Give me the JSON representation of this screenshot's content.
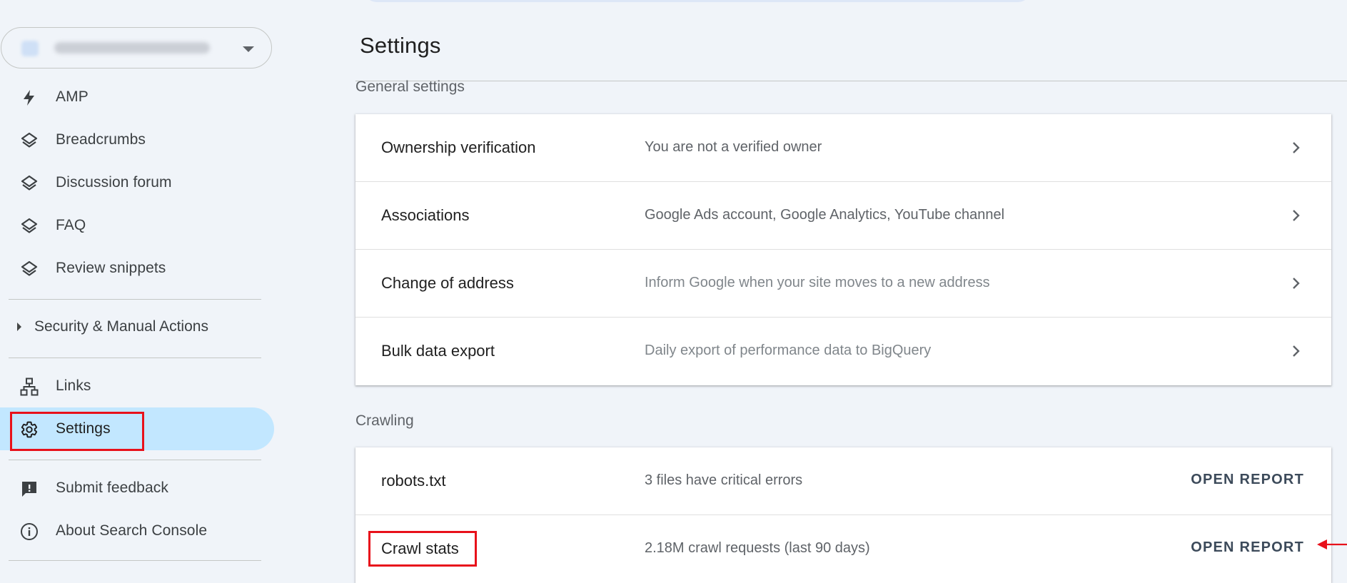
{
  "sidebar": {
    "items_top": [
      {
        "label": "AMP",
        "icon": "lightning-bolt-icon"
      },
      {
        "label": "Breadcrumbs",
        "icon": "layers-icon"
      },
      {
        "label": "Discussion forum",
        "icon": "layers-icon"
      },
      {
        "label": "FAQ",
        "icon": "layers-icon"
      },
      {
        "label": "Review snippets",
        "icon": "layers-icon"
      }
    ],
    "security_group": {
      "label": "Security & Manual Actions"
    },
    "links": {
      "label": "Links",
      "icon": "sitemap-icon"
    },
    "settings": {
      "label": "Settings",
      "icon": "gear-icon"
    },
    "submit_feedback": {
      "label": "Submit feedback",
      "icon": "feedback-icon"
    },
    "about": {
      "label": "About Search Console",
      "icon": "info-icon"
    }
  },
  "main": {
    "title": "Settings",
    "general": {
      "label": "General settings",
      "rows": [
        {
          "title": "Ownership verification",
          "desc": "You are not a verified owner"
        },
        {
          "title": "Associations",
          "desc": "Google Ads account, Google Analytics, YouTube channel"
        },
        {
          "title": "Change of address",
          "desc": "Inform Google when your site moves to a new address"
        },
        {
          "title": "Bulk data export",
          "desc": "Daily export of performance data to BigQuery"
        }
      ]
    },
    "crawling": {
      "label": "Crawling",
      "rows": [
        {
          "title": "robots.txt",
          "desc": "3 files have critical errors",
          "action": "OPEN REPORT"
        },
        {
          "title": "Crawl stats",
          "desc": "2.18M crawl requests (last 90 days)",
          "action": "OPEN REPORT"
        }
      ]
    }
  },
  "colors": {
    "active_nav_bg": "#c2e7ff",
    "annotation_red": "#e8111b",
    "page_bg": "#f0f4f9"
  }
}
